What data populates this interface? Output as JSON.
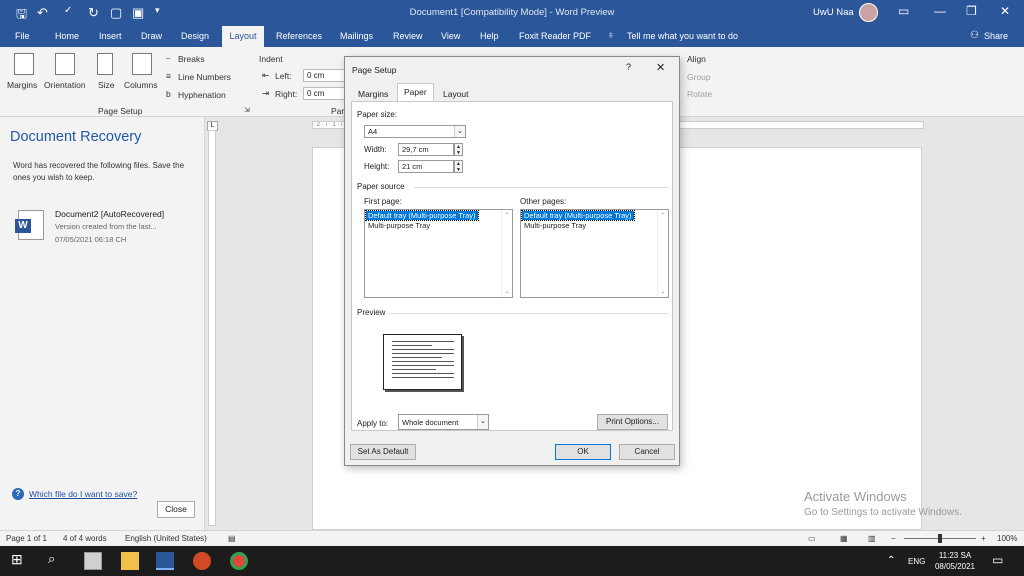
{
  "titlebar": {
    "doc_title": "Document1 [Compatibility Mode] - Word Preview",
    "user_name": "UwU Naa",
    "accent": "#2b579a"
  },
  "menu": {
    "items": [
      "File",
      "Home",
      "Insert",
      "Draw",
      "Design",
      "Layout",
      "References",
      "Mailings",
      "Review",
      "View",
      "Help",
      "Foxit Reader PDF"
    ],
    "active": "Layout",
    "tell_me": "Tell me what you want to do",
    "share": "Share"
  },
  "ribbon": {
    "margins": "Margins",
    "orientation": "Orientation",
    "size": "Size",
    "columns": "Columns",
    "breaks": "Breaks",
    "line_numbers": "Line Numbers",
    "hyphenation": "Hyphenation",
    "page_setup_group": "Page Setup",
    "indent": "Indent",
    "left_label": "Left:",
    "left_value": "0 cm",
    "right_label": "Right:",
    "right_value": "0 cm",
    "para_partial": "Par",
    "align": "Align",
    "group": "Group",
    "rotate": "Rotate"
  },
  "recovery": {
    "title": "Document Recovery",
    "message": "Word has recovered the following files. Save the ones you wish to keep.",
    "file_name": "Document2 [AutoRecovered]",
    "file_desc": "Version created from the last...",
    "file_date": "07/05/2021 06:18 CH",
    "help_link": "Which file do I want to save?",
    "close": "Close"
  },
  "ruler_text": "· 2 · ı · 1 · ı · · · 1 · ı · 2 · ı · 3 · ı · 4 · ı · 5 · ı · 6 · ı · 7 · ı · 8 · ı · 9 · ı · 10 · ı · 11 · ı · 12 · ı · 13 · ı · 14 · ı · 15 · ı · 16 · ı · 17 · ı · 18 · ı · 19",
  "watermark": {
    "line1": "Activate Windows",
    "line2": "Go to Settings to activate Windows."
  },
  "dialog": {
    "title": "Page Setup",
    "help": "?",
    "tabs": [
      "Margins",
      "Paper",
      "Layout"
    ],
    "active_tab": "Paper",
    "paper_size_label": "Paper size:",
    "paper_size_value": "A4",
    "width_label": "Width:",
    "width_value": "29,7 cm",
    "height_label": "Height:",
    "height_value": "21 cm",
    "paper_source_label": "Paper source",
    "first_page_label": "First page:",
    "other_pages_label": "Other pages:",
    "first_page_options": [
      "Default tray (Multi-purpose Tray)",
      "Multi-purpose Tray"
    ],
    "other_pages_options": [
      "Default tray (Multi-purpose Tray)",
      "Multi-purpose Tray"
    ],
    "preview_label": "Preview",
    "apply_to_label": "Apply to:",
    "apply_to_value": "Whole document",
    "print_options": "Print Options...",
    "set_default": "Set As Default",
    "ok": "OK",
    "cancel": "Cancel"
  },
  "status": {
    "page": "Page 1 of 1",
    "words": "4 of 4 words",
    "language": "English (United States)",
    "zoom": "100%"
  },
  "taskbar": {
    "lang": "ENG",
    "time": "11:23 SA",
    "date": "08/05/2021"
  }
}
